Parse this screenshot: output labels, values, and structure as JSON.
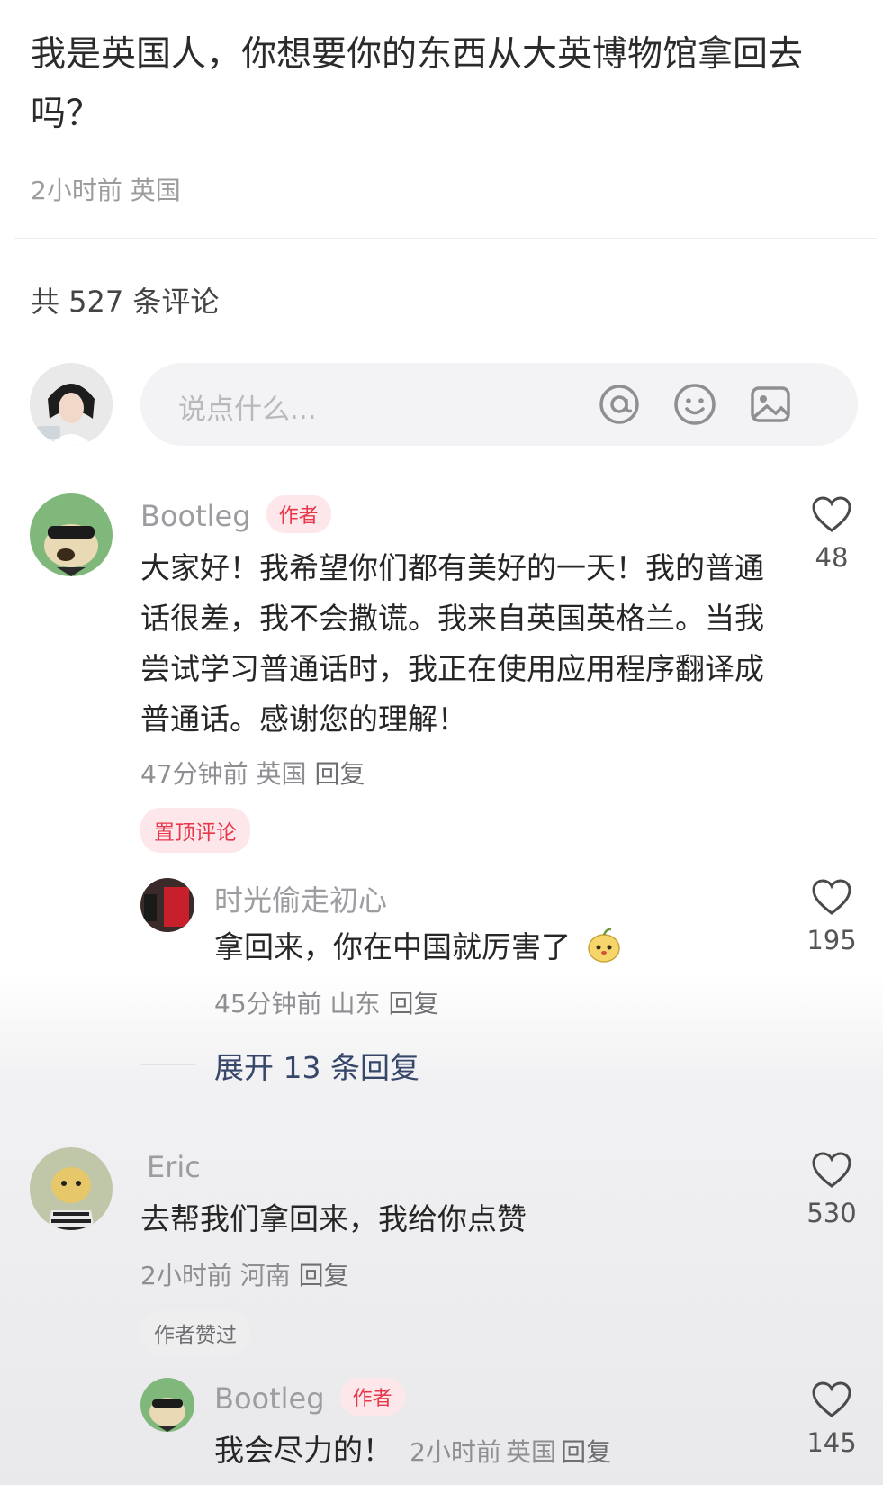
{
  "post": {
    "text": "我是英国人，你想要你的东西从大英博物馆拿回去吗？",
    "time": "2小时前",
    "location": "英国"
  },
  "comments_header": {
    "label": "共 527 条评论"
  },
  "compose": {
    "placeholder": "说点什么..."
  },
  "icons": {
    "mention": "at-icon",
    "emoji": "smiley-icon",
    "image": "image-icon",
    "like": "heart-icon"
  },
  "colors": {
    "accent_red": "#e8374a",
    "link_blue": "#36476a"
  },
  "comments": [
    {
      "user": "Bootleg",
      "badge": "作者",
      "text": "大家好！我希望你们都有美好的一天！我的普通话很差，我不会撒谎。我来自英国英格兰。当我尝试学习普通话时，我正在使用应用程序翻译成普通话。感谢您的理解！",
      "time": "47分钟前",
      "location": "英国",
      "reply_label": "回复",
      "likes": "48",
      "tag": "置顶评论",
      "replies": [
        {
          "user": "时光偷走初心",
          "text": "拿回来，你在中国就厉害了",
          "time": "45分钟前",
          "location": "山东",
          "reply_label": "回复",
          "likes": "195"
        }
      ],
      "expand_label": "展开 13 条回复"
    },
    {
      "user": "Eric",
      "text": "去帮我们拿回来，我给你点赞",
      "time": "2小时前",
      "location": "河南",
      "reply_label": "回复",
      "likes": "530",
      "tag": "作者赞过",
      "replies": [
        {
          "user": "Bootleg",
          "badge": "作者",
          "text": "我会尽力的！",
          "time": "2小时前",
          "location": "英国",
          "reply_label": "回复",
          "likes": "145"
        }
      ]
    }
  ]
}
